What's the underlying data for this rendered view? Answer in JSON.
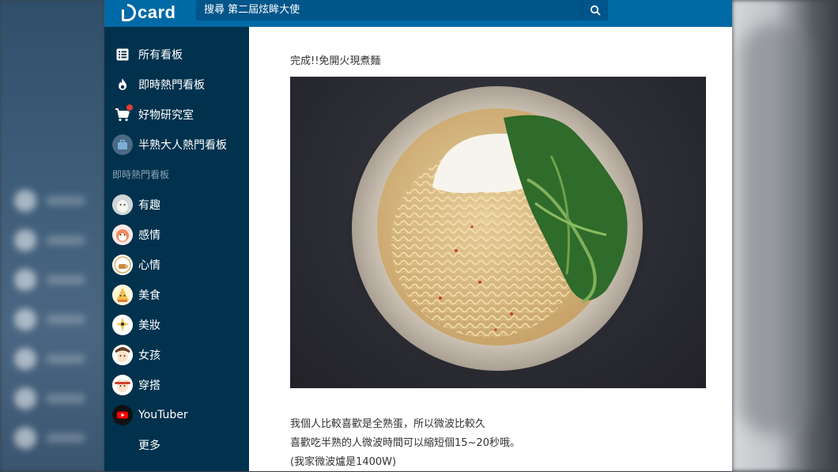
{
  "app": {
    "logo_text": "card"
  },
  "search": {
    "text": "搜尋 第二屆炫眸大使"
  },
  "sidebar": {
    "main_items": [
      {
        "label": "所有看板",
        "icon": "list-icon"
      },
      {
        "label": "即時熱門看板",
        "icon": "fire-icon"
      },
      {
        "label": "好物研究室",
        "icon": "cart-icon",
        "badge": true
      },
      {
        "label": "半熟大人熱門看板",
        "icon": "briefcase-avatar-icon"
      }
    ],
    "section_title": "即時熱門看板",
    "boards": [
      {
        "label": "有趣"
      },
      {
        "label": "感情"
      },
      {
        "label": "心情"
      },
      {
        "label": "美食"
      },
      {
        "label": "美妝"
      },
      {
        "label": "女孩"
      },
      {
        "label": "穿搭"
      },
      {
        "label": "YouTuber"
      },
      {
        "label": "更多"
      }
    ]
  },
  "post": {
    "heading": "完成!!免開火現煮麵",
    "lines": [
      "我個人比較喜歡是全熟蛋，所以微波比較久",
      "喜歡吃半熟的人微波時間可以縮短個15~20秒哦。",
      "(我家微波爐是1400W)"
    ]
  },
  "colors": {
    "topbar": "#006aa6",
    "sidebar": "#00324e",
    "content_bg": "#ffffff"
  }
}
